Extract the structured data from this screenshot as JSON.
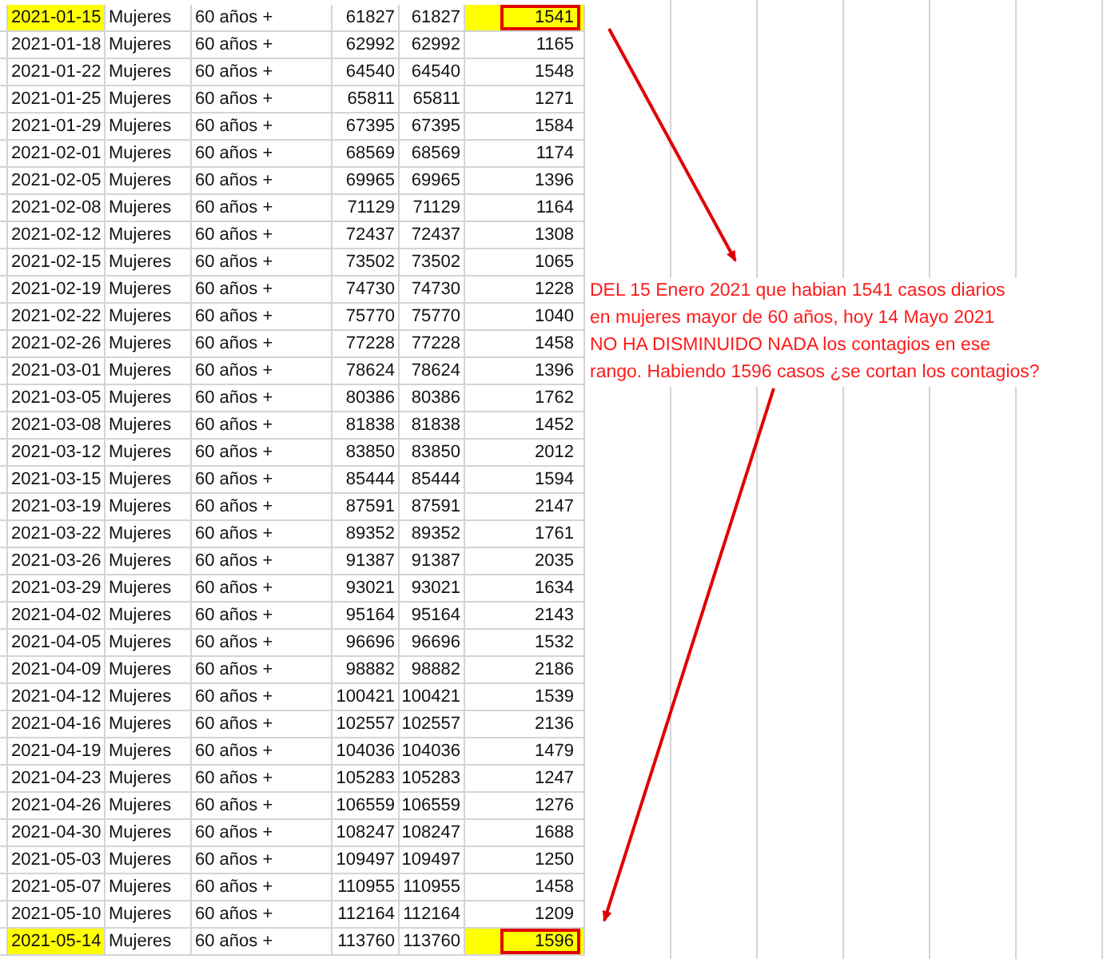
{
  "rows": [
    {
      "date": "2021-01-15",
      "sex": "Mujeres",
      "age": "60 años +",
      "col_4": "61827",
      "col_5": "61827",
      "col_6": "1541",
      "highlighted": true,
      "boxed": true
    },
    {
      "date": "2021-01-18",
      "sex": "Mujeres",
      "age": "60 años +",
      "col_4": "62992",
      "col_5": "62992",
      "col_6": "1165",
      "highlighted": false,
      "boxed": false
    },
    {
      "date": "2021-01-22",
      "sex": "Mujeres",
      "age": "60 años +",
      "col_4": "64540",
      "col_5": "64540",
      "col_6": "1548",
      "highlighted": false,
      "boxed": false
    },
    {
      "date": "2021-01-25",
      "sex": "Mujeres",
      "age": "60 años +",
      "col_4": "65811",
      "col_5": "65811",
      "col_6": "1271",
      "highlighted": false,
      "boxed": false
    },
    {
      "date": "2021-01-29",
      "sex": "Mujeres",
      "age": "60 años +",
      "col_4": "67395",
      "col_5": "67395",
      "col_6": "1584",
      "highlighted": false,
      "boxed": false
    },
    {
      "date": "2021-02-01",
      "sex": "Mujeres",
      "age": "60 años +",
      "col_4": "68569",
      "col_5": "68569",
      "col_6": "1174",
      "highlighted": false,
      "boxed": false
    },
    {
      "date": "2021-02-05",
      "sex": "Mujeres",
      "age": "60 años +",
      "col_4": "69965",
      "col_5": "69965",
      "col_6": "1396",
      "highlighted": false,
      "boxed": false
    },
    {
      "date": "2021-02-08",
      "sex": "Mujeres",
      "age": "60 años +",
      "col_4": "71129",
      "col_5": "71129",
      "col_6": "1164",
      "highlighted": false,
      "boxed": false
    },
    {
      "date": "2021-02-12",
      "sex": "Mujeres",
      "age": "60 años +",
      "col_4": "72437",
      "col_5": "72437",
      "col_6": "1308",
      "highlighted": false,
      "boxed": false
    },
    {
      "date": "2021-02-15",
      "sex": "Mujeres",
      "age": "60 años +",
      "col_4": "73502",
      "col_5": "73502",
      "col_6": "1065",
      "highlighted": false,
      "boxed": false
    },
    {
      "date": "2021-02-19",
      "sex": "Mujeres",
      "age": "60 años +",
      "col_4": "74730",
      "col_5": "74730",
      "col_6": "1228",
      "highlighted": false,
      "boxed": false
    },
    {
      "date": "2021-02-22",
      "sex": "Mujeres",
      "age": "60 años +",
      "col_4": "75770",
      "col_5": "75770",
      "col_6": "1040",
      "highlighted": false,
      "boxed": false
    },
    {
      "date": "2021-02-26",
      "sex": "Mujeres",
      "age": "60 años +",
      "col_4": "77228",
      "col_5": "77228",
      "col_6": "1458",
      "highlighted": false,
      "boxed": false
    },
    {
      "date": "2021-03-01",
      "sex": "Mujeres",
      "age": "60 años +",
      "col_4": "78624",
      "col_5": "78624",
      "col_6": "1396",
      "highlighted": false,
      "boxed": false
    },
    {
      "date": "2021-03-05",
      "sex": "Mujeres",
      "age": "60 años +",
      "col_4": "80386",
      "col_5": "80386",
      "col_6": "1762",
      "highlighted": false,
      "boxed": false
    },
    {
      "date": "2021-03-08",
      "sex": "Mujeres",
      "age": "60 años +",
      "col_4": "81838",
      "col_5": "81838",
      "col_6": "1452",
      "highlighted": false,
      "boxed": false
    },
    {
      "date": "2021-03-12",
      "sex": "Mujeres",
      "age": "60 años +",
      "col_4": "83850",
      "col_5": "83850",
      "col_6": "2012",
      "highlighted": false,
      "boxed": false
    },
    {
      "date": "2021-03-15",
      "sex": "Mujeres",
      "age": "60 años +",
      "col_4": "85444",
      "col_5": "85444",
      "col_6": "1594",
      "highlighted": false,
      "boxed": false
    },
    {
      "date": "2021-03-19",
      "sex": "Mujeres",
      "age": "60 años +",
      "col_4": "87591",
      "col_5": "87591",
      "col_6": "2147",
      "highlighted": false,
      "boxed": false
    },
    {
      "date": "2021-03-22",
      "sex": "Mujeres",
      "age": "60 años +",
      "col_4": "89352",
      "col_5": "89352",
      "col_6": "1761",
      "highlighted": false,
      "boxed": false
    },
    {
      "date": "2021-03-26",
      "sex": "Mujeres",
      "age": "60 años +",
      "col_4": "91387",
      "col_5": "91387",
      "col_6": "2035",
      "highlighted": false,
      "boxed": false
    },
    {
      "date": "2021-03-29",
      "sex": "Mujeres",
      "age": "60 años +",
      "col_4": "93021",
      "col_5": "93021",
      "col_6": "1634",
      "highlighted": false,
      "boxed": false
    },
    {
      "date": "2021-04-02",
      "sex": "Mujeres",
      "age": "60 años +",
      "col_4": "95164",
      "col_5": "95164",
      "col_6": "2143",
      "highlighted": false,
      "boxed": false
    },
    {
      "date": "2021-04-05",
      "sex": "Mujeres",
      "age": "60 años +",
      "col_4": "96696",
      "col_5": "96696",
      "col_6": "1532",
      "highlighted": false,
      "boxed": false
    },
    {
      "date": "2021-04-09",
      "sex": "Mujeres",
      "age": "60 años +",
      "col_4": "98882",
      "col_5": "98882",
      "col_6": "2186",
      "highlighted": false,
      "boxed": false
    },
    {
      "date": "2021-04-12",
      "sex": "Mujeres",
      "age": "60 años +",
      "col_4": "100421",
      "col_5": "100421",
      "col_6": "1539",
      "highlighted": false,
      "boxed": false
    },
    {
      "date": "2021-04-16",
      "sex": "Mujeres",
      "age": "60 años +",
      "col_4": "102557",
      "col_5": "102557",
      "col_6": "2136",
      "highlighted": false,
      "boxed": false
    },
    {
      "date": "2021-04-19",
      "sex": "Mujeres",
      "age": "60 años +",
      "col_4": "104036",
      "col_5": "104036",
      "col_6": "1479",
      "highlighted": false,
      "boxed": false
    },
    {
      "date": "2021-04-23",
      "sex": "Mujeres",
      "age": "60 años +",
      "col_4": "105283",
      "col_5": "105283",
      "col_6": "1247",
      "highlighted": false,
      "boxed": false
    },
    {
      "date": "2021-04-26",
      "sex": "Mujeres",
      "age": "60 años +",
      "col_4": "106559",
      "col_5": "106559",
      "col_6": "1276",
      "highlighted": false,
      "boxed": false
    },
    {
      "date": "2021-04-30",
      "sex": "Mujeres",
      "age": "60 años +",
      "col_4": "108247",
      "col_5": "108247",
      "col_6": "1688",
      "highlighted": false,
      "boxed": false
    },
    {
      "date": "2021-05-03",
      "sex": "Mujeres",
      "age": "60 años +",
      "col_4": "109497",
      "col_5": "109497",
      "col_6": "1250",
      "highlighted": false,
      "boxed": false
    },
    {
      "date": "2021-05-07",
      "sex": "Mujeres",
      "age": "60 años +",
      "col_4": "110955",
      "col_5": "110955",
      "col_6": "1458",
      "highlighted": false,
      "boxed": false
    },
    {
      "date": "2021-05-10",
      "sex": "Mujeres",
      "age": "60 años +",
      "col_4": "112164",
      "col_5": "112164",
      "col_6": "1209",
      "highlighted": false,
      "boxed": false
    },
    {
      "date": "2021-05-14",
      "sex": "Mujeres",
      "age": "60 años +",
      "col_4": "113760",
      "col_5": "113760",
      "col_6": "1596",
      "highlighted": true,
      "boxed": true
    }
  ],
  "annotation": {
    "lines": [
      "DEL 15 Enero 2021 que habian 1541 casos diarios",
      "en mujeres mayor de 60 años, hoy 14 Mayo 2021",
      "NO HA DISMINUIDO NADA los contagios en ese",
      "rango. Habiendo 1596 casos ¿se cortan los contagios?"
    ]
  }
}
